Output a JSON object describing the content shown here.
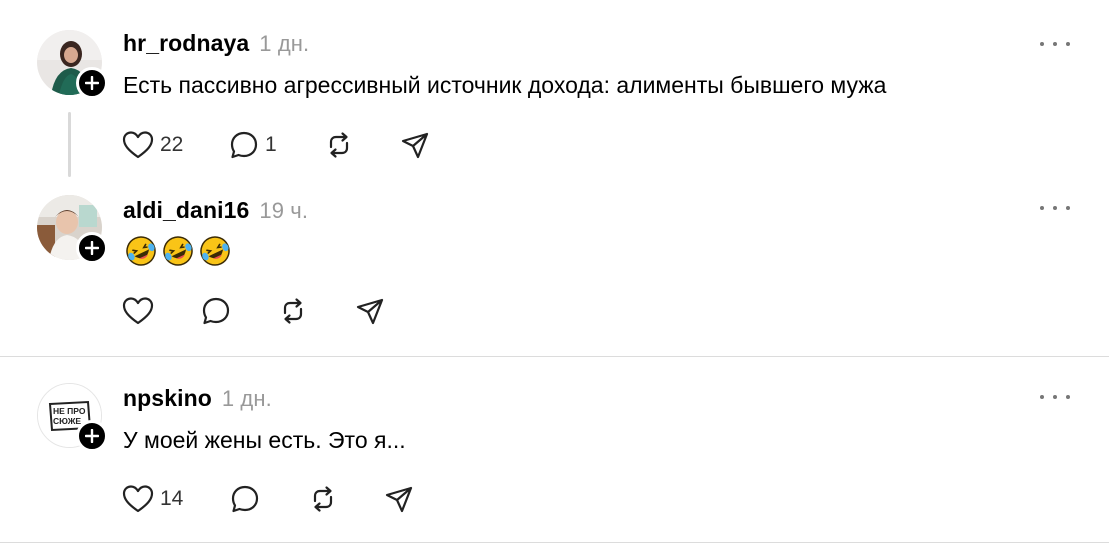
{
  "posts": [
    {
      "username": "hr_rodnaya",
      "time": "1 дн.",
      "text": "Есть пассивно агрессивный источник дохода: алименты бывшего мужа",
      "likes": "22",
      "replies": "1"
    },
    {
      "username": "aldi_dani16",
      "time": "19 ч.",
      "emojis": [
        "🤣",
        "🤣",
        "🤣"
      ]
    },
    {
      "username": "npskino",
      "time": "1 дн.",
      "text": "У моей жены есть. Это я...",
      "likes": "14",
      "avatar_logo_text": [
        "НЕ ПРО",
        "СЮЖЕ"
      ]
    }
  ],
  "colors": {
    "timestamp": "#999999",
    "icon": "#222222",
    "divider": "#dcdcdc",
    "badge": "#000000"
  },
  "icons": [
    "heart-icon",
    "comment-icon",
    "repost-icon",
    "share-icon",
    "more-icon",
    "plus-icon"
  ]
}
